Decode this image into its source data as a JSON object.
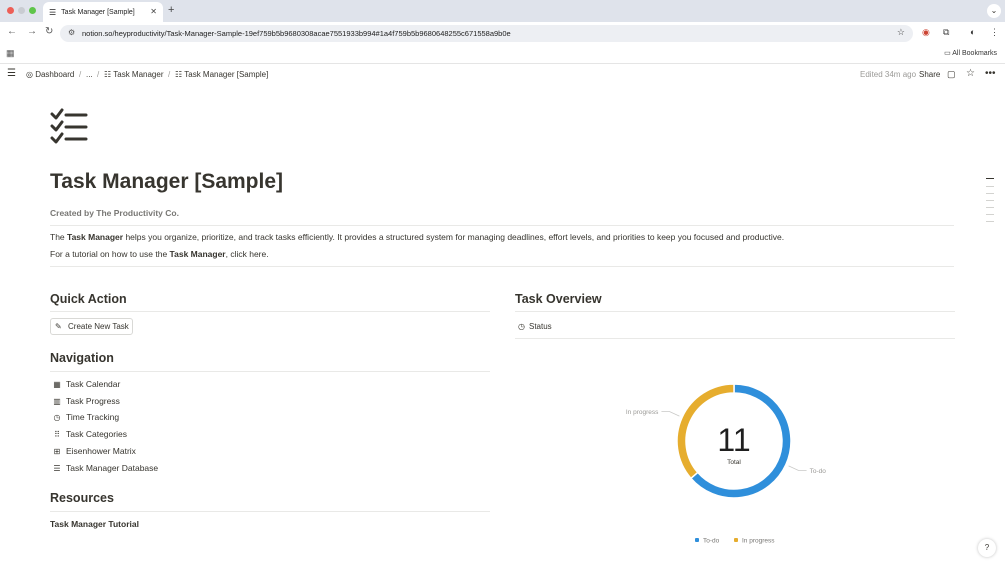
{
  "browser": {
    "tab_title": "Task Manager [Sample]",
    "url": "notion.so/heyproductivity/Task-Manager-Sample-19ef759b5b9680308acae7551933b994#1a4f759b5b9680648255c671558a9b0e",
    "all_bookmarks": "All Bookmarks"
  },
  "breadcrumb": {
    "dashboard": "Dashboard",
    "ellipsis": "...",
    "task_manager": "Task Manager",
    "current": "Task Manager [Sample]"
  },
  "topbar": {
    "edited": "Edited 34m ago",
    "share": "Share"
  },
  "page": {
    "title": "Task Manager [Sample]",
    "creator": "Created by The Productivity Co.",
    "desc1_pre": "The ",
    "desc1_bold": "Task Manager",
    "desc1_post": " helps you organize, prioritize, and track tasks efficiently. It provides a structured system for managing deadlines, effort levels, and priorities to keep you focused and productive.",
    "desc2_pre": "For a tutorial on how to use the ",
    "desc2_bold": "Task Manager",
    "desc2_post": ", click here."
  },
  "quick_action": {
    "heading": "Quick Action",
    "create_button": "Create New Task"
  },
  "navigation": {
    "heading": "Navigation",
    "items": [
      {
        "label": "Task Calendar",
        "icon": "calendar-icon"
      },
      {
        "label": "Task Progress",
        "icon": "columns-icon"
      },
      {
        "label": "Time Tracking",
        "icon": "clock-icon"
      },
      {
        "label": "Task Categories",
        "icon": "grid-icon"
      },
      {
        "label": "Eisenhower Matrix",
        "icon": "matrix-icon"
      },
      {
        "label": "Task Manager Database",
        "icon": "database-icon"
      }
    ]
  },
  "resources": {
    "heading": "Resources",
    "link": "Task Manager Tutorial"
  },
  "overview": {
    "heading": "Task Overview",
    "view_tab": "Status"
  },
  "chart_data": {
    "type": "pie",
    "total": 11,
    "total_label": "Total",
    "series": [
      {
        "name": "To-do",
        "value": 7,
        "color": "#2f8fdb"
      },
      {
        "name": "In progress",
        "value": 4,
        "color": "#e6ad2e"
      }
    ],
    "legend": [
      "To-do",
      "In progress"
    ]
  }
}
